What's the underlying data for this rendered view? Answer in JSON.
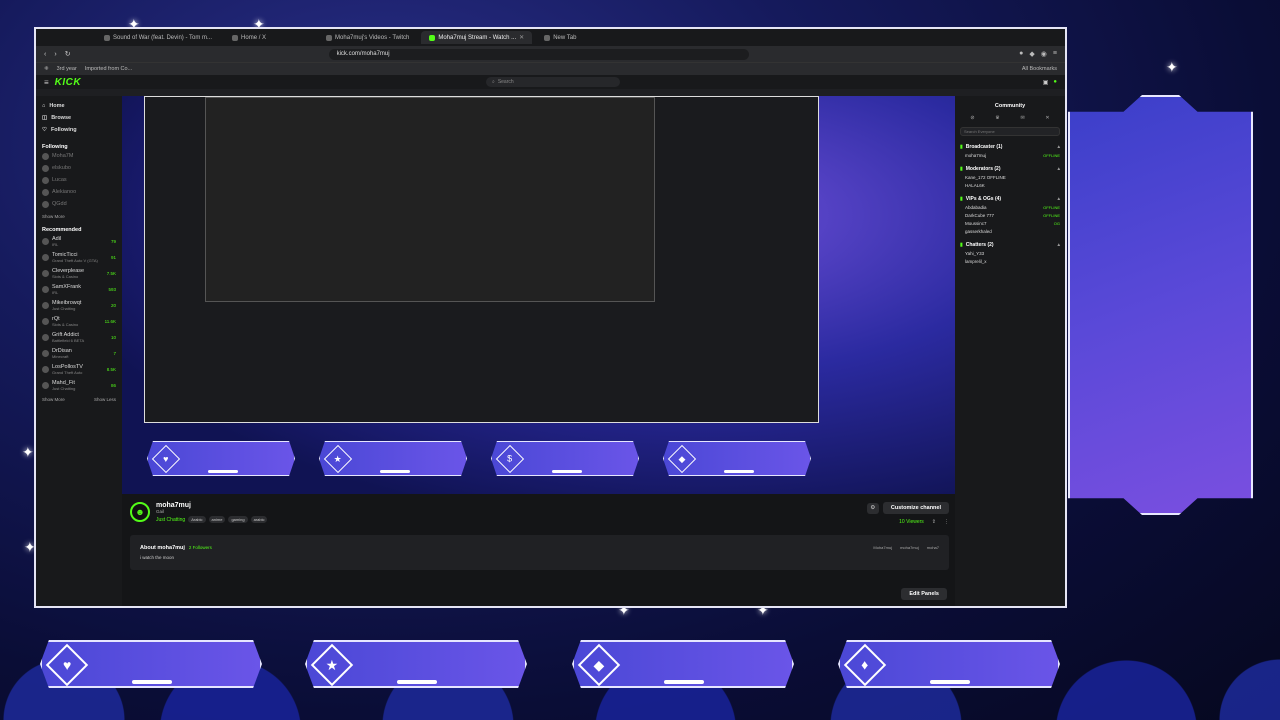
{
  "browser": {
    "tabs": [
      {
        "label": "Sound of War (feat. Devin) - Tom m...",
        "active": false
      },
      {
        "label": "Home / X",
        "active": false
      },
      {
        "label": "Moha7muj's Videos - Twitch",
        "active": false
      },
      {
        "label": "Moha7muj Stream - Watch ...",
        "active": true
      },
      {
        "label": "New Tab",
        "active": false
      }
    ],
    "url": "kick.com/moha7muj",
    "bookmarks": [
      "3rd year",
      "Imported from Co..."
    ],
    "all_bookmarks": "All Bookmarks"
  },
  "kick": {
    "logo": "KICK",
    "search_placeholder": "Search",
    "nav": {
      "home": "Home",
      "browse": "Browse",
      "following": "Following"
    },
    "following_header": "Following",
    "following": [
      {
        "name": "Moha7M",
        "viewers": ""
      },
      {
        "name": "elskubo",
        "viewers": ""
      },
      {
        "name": "Lucas",
        "viewers": ""
      },
      {
        "name": "Alekianoo",
        "viewers": ""
      },
      {
        "name": "QGdd",
        "viewers": ""
      }
    ],
    "show_more": "Show More",
    "recommended_header": "Recommended",
    "recommended": [
      {
        "name": "Adil",
        "sub": "IRL",
        "viewers": "79"
      },
      {
        "name": "TomicTicci",
        "sub": "Grand Theft Auto V (GTA)",
        "viewers": "91"
      },
      {
        "name": "Cleverplease",
        "sub": "Slots & Casino",
        "viewers": "7.5K"
      },
      {
        "name": "SamXFrank",
        "sub": "IRL",
        "viewers": "593"
      },
      {
        "name": "Mikeibrowqt",
        "sub": "Just Chatting",
        "viewers": "20"
      },
      {
        "name": "rQt",
        "sub": "Slots & Casino",
        "viewers": "11.6K"
      },
      {
        "name": "Grift Addict",
        "sub": "Battlefield 6 BETA",
        "viewers": "10"
      },
      {
        "name": "DrDisan",
        "sub": "Minecraft",
        "viewers": "7"
      },
      {
        "name": "LosPollosTV",
        "sub": "Grand Theft Auto",
        "viewers": "8.5K"
      },
      {
        "name": "Mahd_Fit",
        "sub": "Just Chatting",
        "viewers": "86"
      }
    ],
    "show_less": "Show Less",
    "channel": {
      "name": "moha7muj",
      "subtitle": "Gail",
      "category": "Just Chatting",
      "tags": [
        "Arabic",
        "anime",
        "gaming",
        "arabic"
      ],
      "customize": "Customize channel",
      "viewers": "10 Viewers",
      "about_title": "About moha7muj",
      "followers": "2 Followers",
      "bio": "i watch the moon",
      "socials": [
        "Moha7muj",
        "moha7muj",
        "moha7"
      ],
      "edit_panels": "Edit Panels"
    },
    "chat": {
      "title": "Community",
      "search_placeholder": "Search Everyone",
      "groups": [
        {
          "label": "Broadcaster (1)",
          "users": [
            {
              "name": "moha7muj",
              "badge": "OFFLINE"
            }
          ]
        },
        {
          "label": "Moderators (2)",
          "users": [
            {
              "name": "Kane_172 OFFLINE",
              "badge": ""
            },
            {
              "name": "HALAL6K",
              "badge": ""
            }
          ]
        },
        {
          "label": "VIPs & OGs (4)",
          "users": [
            {
              "name": "Abdabadia",
              "badge": "OFFLINE"
            },
            {
              "name": "DarkCube 777",
              "badge": "OFFLINE"
            },
            {
              "name": "Moussinc7",
              "badge": "OG"
            },
            {
              "name": "gasserkhaled",
              "badge": ""
            }
          ]
        },
        {
          "label": "Chatters (2)",
          "users": [
            {
              "name": "Yahi_Y33",
              "badge": ""
            },
            {
              "name": "lamprelil_x",
              "badge": ""
            }
          ]
        }
      ]
    }
  },
  "bottom_tiles": [
    {
      "icon": "♥"
    },
    {
      "icon": "★"
    },
    {
      "icon": "◆"
    },
    {
      "icon": "♦"
    }
  ],
  "stream_tiles": [
    {
      "icon": "♥"
    },
    {
      "icon": "★"
    },
    {
      "icon": "$"
    },
    {
      "icon": "◆"
    }
  ],
  "colors": {
    "accent": "#53fc18",
    "tile": "#5a4fe0",
    "bg": "#141517"
  }
}
